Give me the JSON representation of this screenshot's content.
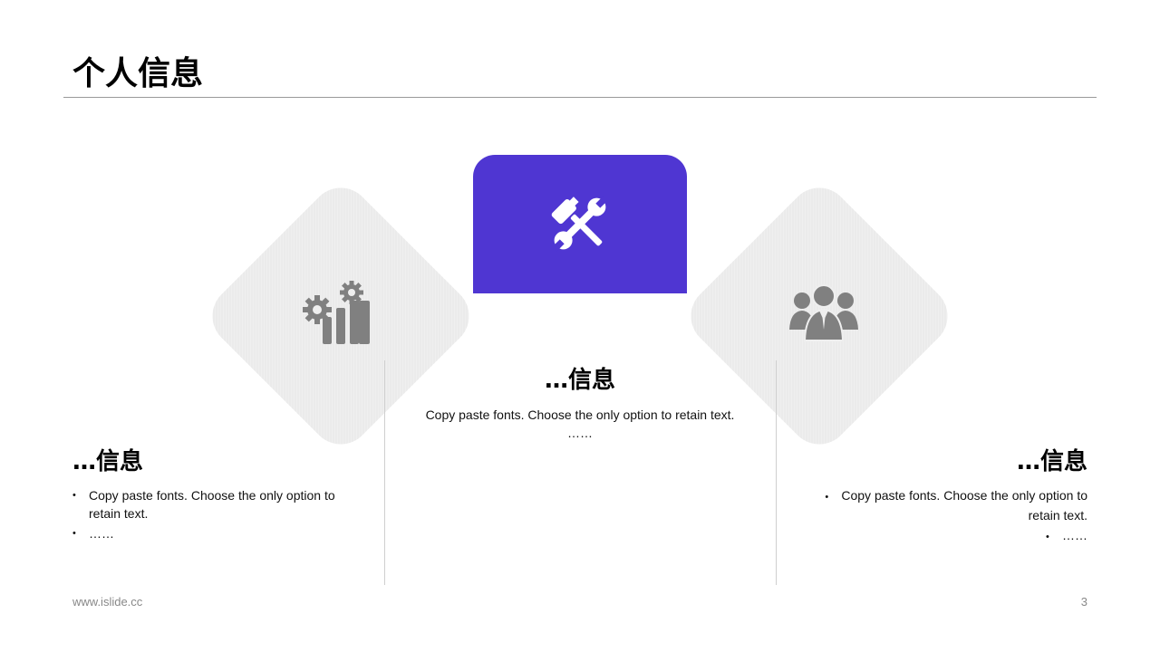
{
  "slide": {
    "title": "个人信息"
  },
  "icons": {
    "left": "chart-gears-icon",
    "center": "tools-icon",
    "right": "team-icon"
  },
  "colors": {
    "accent": "#4f36d2",
    "diamond": "#efefef",
    "icon_gray": "#808080"
  },
  "center_block": {
    "heading": "…信息",
    "text": "Copy paste fonts. Choose the only option to retain text.",
    "ellipsis": "……"
  },
  "left_block": {
    "heading": "…信息",
    "bullets": [
      "Copy paste fonts. Choose the only option to retain text.",
      "……"
    ]
  },
  "right_block": {
    "heading": "…信息",
    "bullets": [
      "Copy paste fonts. Choose the only option to retain text.",
      "……"
    ]
  },
  "footer": {
    "url": "www.islide.cc",
    "page": "3"
  }
}
